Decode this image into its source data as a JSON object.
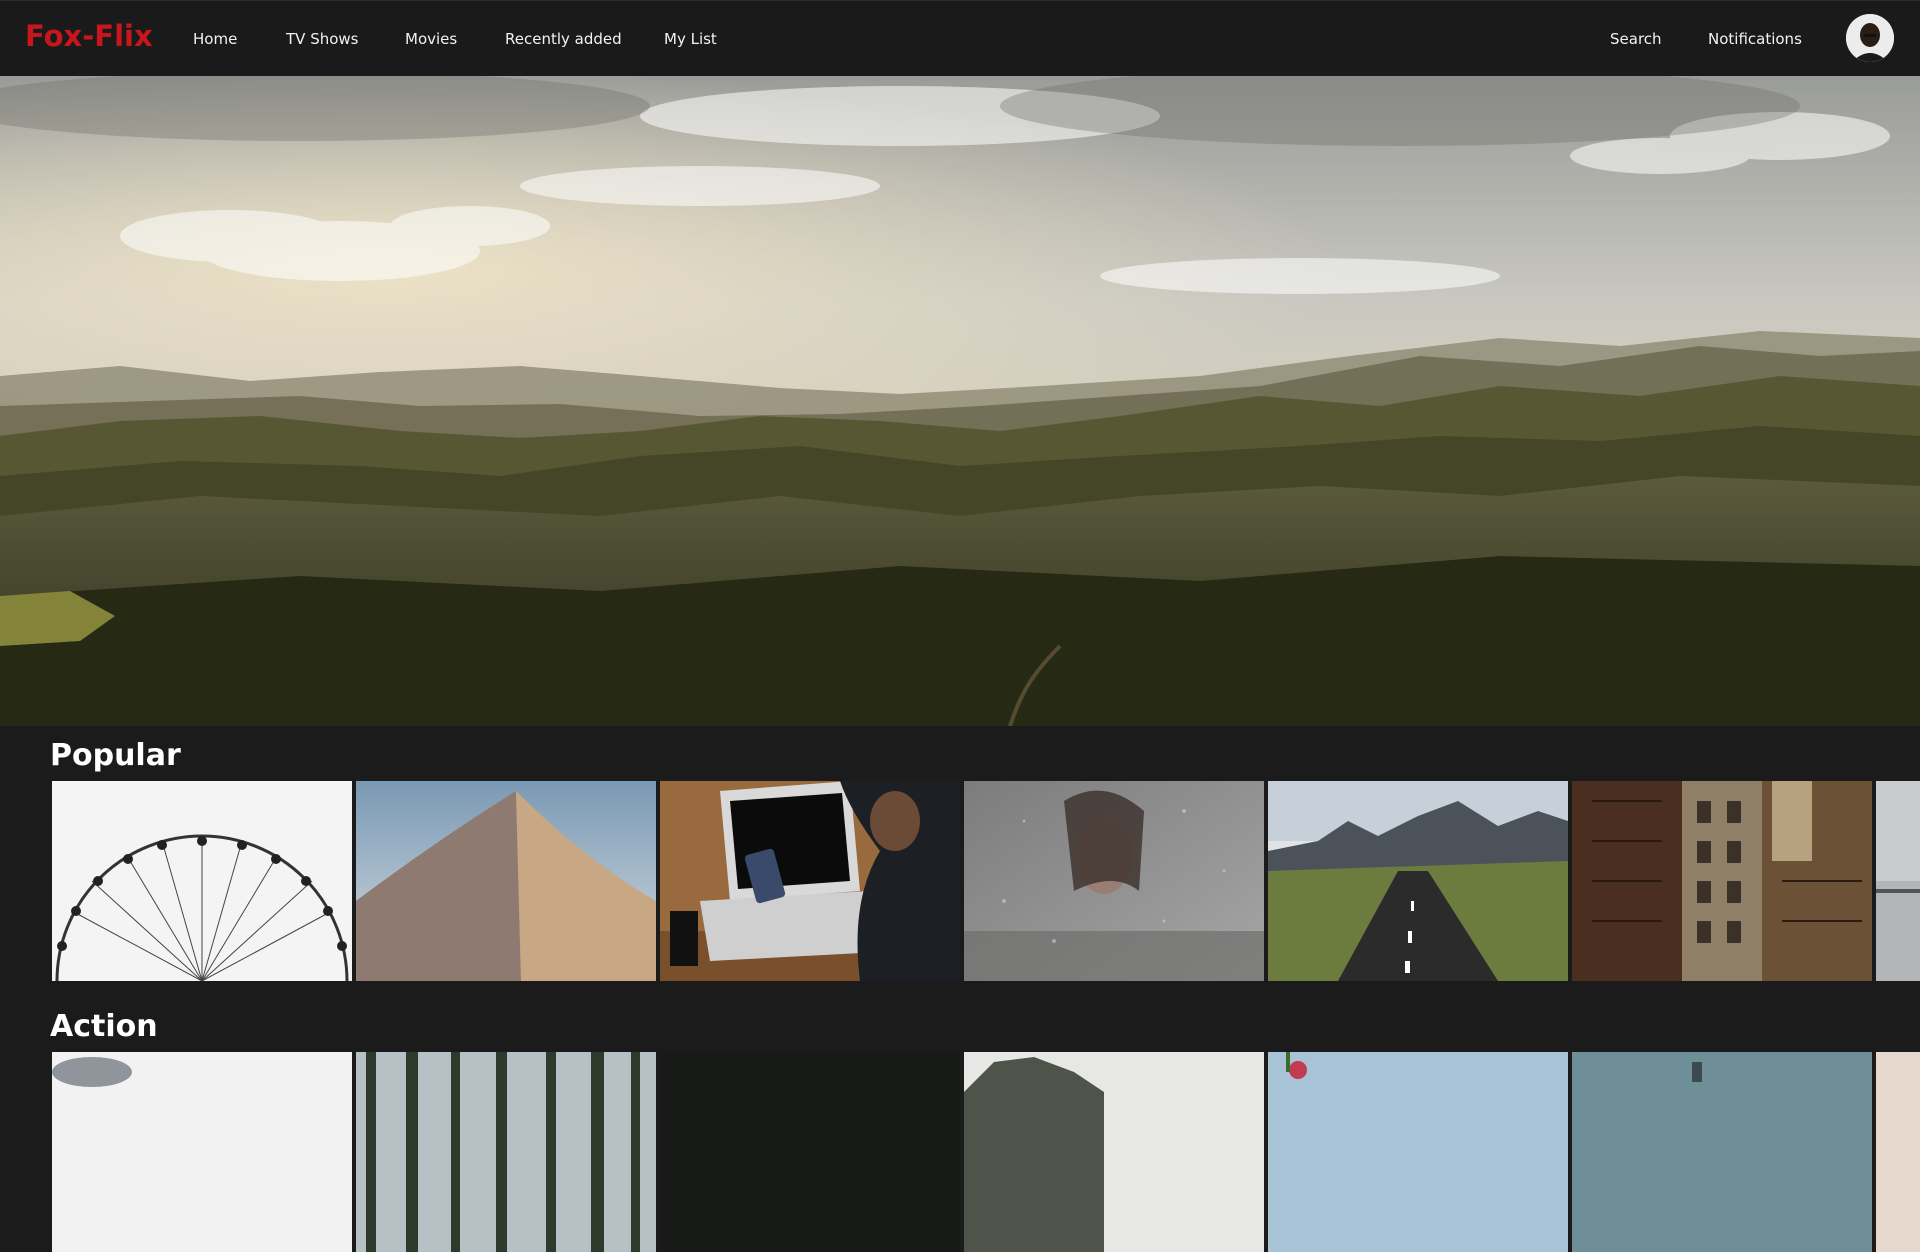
{
  "brand": {
    "name": "Fox-Flix",
    "color": "#c8161d"
  },
  "nav": {
    "items": [
      {
        "label": "Home"
      },
      {
        "label": "TV Shows"
      },
      {
        "label": "Movies"
      },
      {
        "label": "Recently added"
      },
      {
        "label": "My List"
      }
    ],
    "right": [
      {
        "label": "Search"
      },
      {
        "label": "Notifications"
      }
    ]
  },
  "hero": {
    "image": "landscape-hills-clouds"
  },
  "sections": [
    {
      "title": "Popular",
      "tiles": [
        {
          "image": "ferris-wheel"
        },
        {
          "image": "sand-dune"
        },
        {
          "image": "laptop-phone-desk"
        },
        {
          "image": "woman-rain-window"
        },
        {
          "image": "road-mountains"
        },
        {
          "image": "fire-escape-buildings"
        },
        {
          "image": "pier-sea"
        }
      ]
    },
    {
      "title": "Action",
      "tiles": [
        {
          "image": "sky-white"
        },
        {
          "image": "forest-trees"
        },
        {
          "image": "dark-scene"
        },
        {
          "image": "rocky-hill"
        },
        {
          "image": "flowers-sky"
        },
        {
          "image": "teal-sky"
        },
        {
          "image": "partial-tile"
        }
      ]
    }
  ]
}
